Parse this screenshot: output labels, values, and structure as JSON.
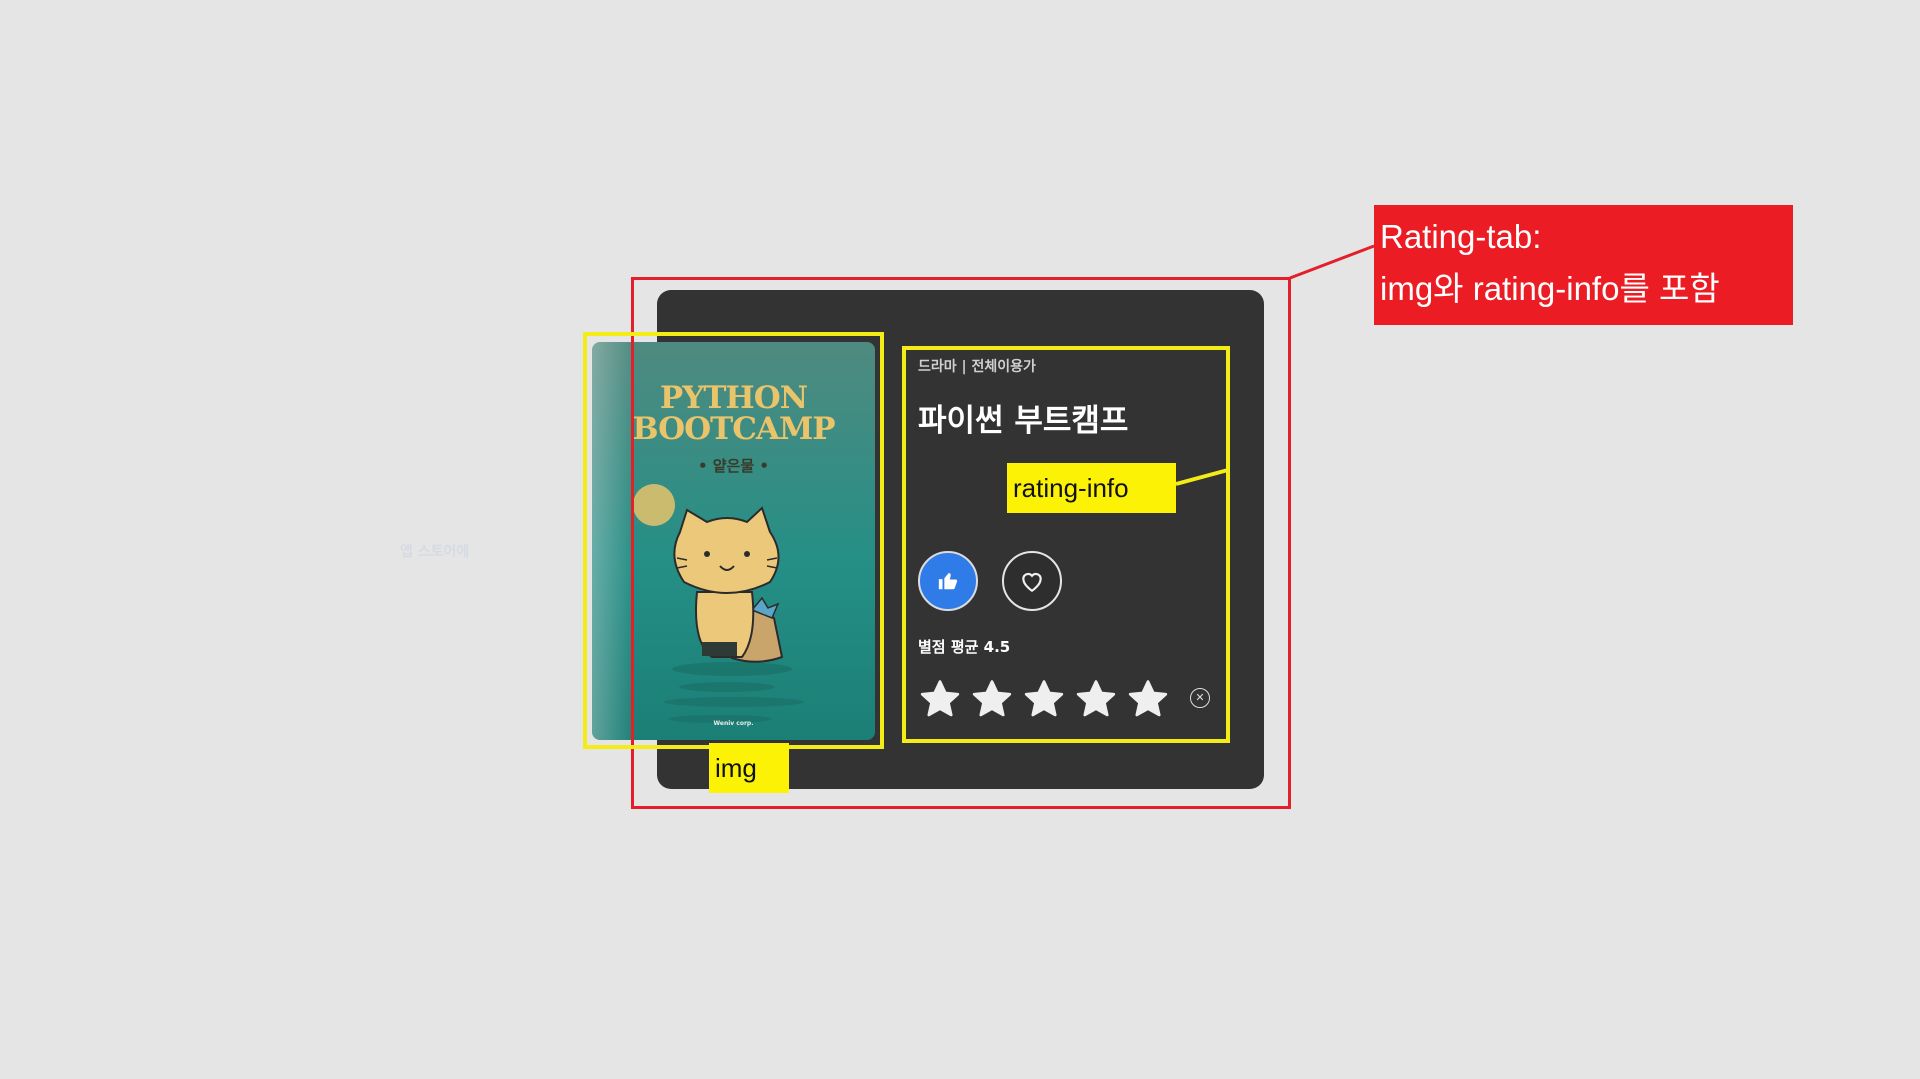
{
  "background_note_text": "앱 스토어에",
  "poster": {
    "title_line1": "PYTHON",
    "title_line2": "BOOTCAMP",
    "subtitle": "• 얕은물 •",
    "footer": "Weniv corp."
  },
  "rating_info": {
    "meta": "드라마 | 전체이용가",
    "title": "파이썬 부트캠프",
    "like_icon": "thumbs-up-icon",
    "favorite_icon": "heart-icon",
    "average_label": "별점 평균 4.5",
    "stars": 5,
    "clear_icon": "close-circle-icon"
  },
  "annotations": {
    "rating_tab_line1": "Rating-tab:",
    "rating_tab_line2": "img와 rating-info를 포함",
    "img_label": "img",
    "rating_info_label": "rating-info"
  },
  "colors": {
    "card": "#333333",
    "like_button": "#2f7be8",
    "annotation_red": "#e3202a",
    "annotation_yellow": "#f4ec16",
    "poster_title": "#e9c46a"
  }
}
